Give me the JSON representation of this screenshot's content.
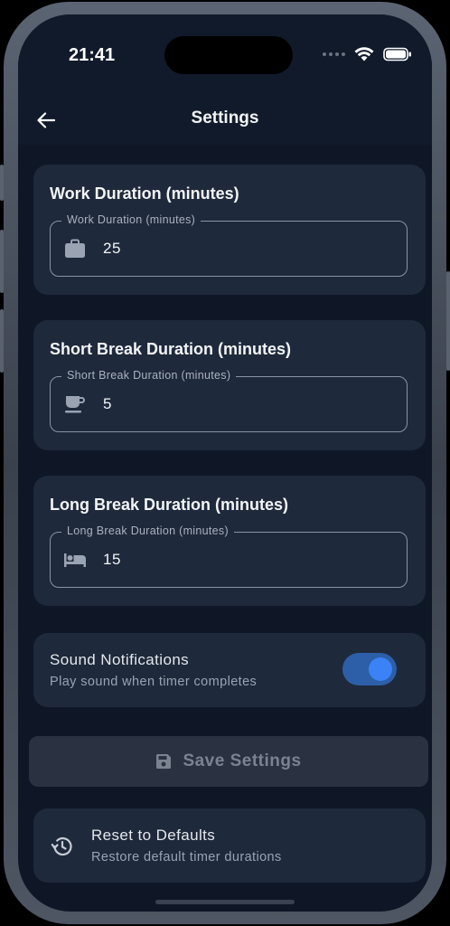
{
  "status_bar": {
    "time": "21:41"
  },
  "app_bar": {
    "title": "Settings"
  },
  "cards": [
    {
      "title": "Work Duration (minutes)",
      "field_label": "Work Duration (minutes)",
      "value": "25",
      "icon": "briefcase-icon"
    },
    {
      "title": "Short Break Duration (minutes)",
      "field_label": "Short Break Duration (minutes)",
      "value": "5",
      "icon": "coffee-icon"
    },
    {
      "title": "Long Break Duration (minutes)",
      "field_label": "Long Break Duration (minutes)",
      "value": "15",
      "icon": "bed-icon"
    }
  ],
  "sound": {
    "title": "Sound Notifications",
    "subtitle": "Play sound when timer completes",
    "enabled": true
  },
  "save_button": {
    "label": "Save Settings",
    "icon": "save-icon"
  },
  "reset": {
    "title": "Reset to Defaults",
    "subtitle": "Restore default timer durations",
    "icon": "history-icon"
  },
  "colors": {
    "background": "#0f1726",
    "card": "#1e293b",
    "accent": "#3b82f6",
    "toggle_track": "#2d5fa8",
    "disabled_button": "#2a3140"
  }
}
